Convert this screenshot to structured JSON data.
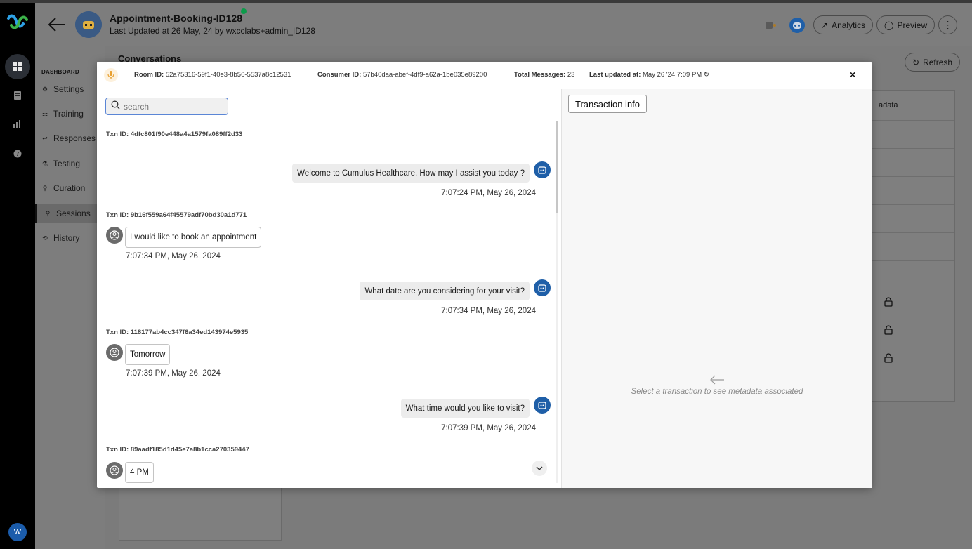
{
  "app": {
    "title": "Appointment-Booking-ID128",
    "subtitle": "Last Updated at 26 May, 24 by wxcclabs+admin_ID128",
    "avatar_letter": "W"
  },
  "header": {
    "analytics_label": "Analytics",
    "preview_label": "Preview",
    "more_label": "⋮"
  },
  "sidebar": {
    "caption": "DASHBOARD",
    "items": [
      {
        "label": "Settings",
        "icon": "⚙"
      },
      {
        "label": "Training",
        "icon": "⚏"
      },
      {
        "label": "Responses",
        "icon": "↩"
      },
      {
        "label": "Testing",
        "icon": "⚗"
      },
      {
        "label": "Curation",
        "icon": "⚲"
      },
      {
        "label": "Sessions",
        "icon": "⚲",
        "active": true
      },
      {
        "label": "History",
        "icon": "⟲"
      }
    ]
  },
  "page": {
    "title": "Conversations",
    "refresh_label": "Refresh",
    "table_header_partial": "adata"
  },
  "modal": {
    "room_label": "Room ID:",
    "room_id": "52a75316-59f1-40e3-8b56-5537a8c12531",
    "consumer_label": "Consumer ID:",
    "consumer_id": "57b40daa-abef-4df9-a62a-1be035e89200",
    "total_label": "Total Messages:",
    "total_messages": "23",
    "updated_label": "Last updated at:",
    "updated_at": "May 26 '24 7:09 PM",
    "close_label": "×",
    "search_placeholder": "search",
    "transaction_info_label": "Transaction info",
    "empty_state": "Select a transaction to see metadata associated",
    "txns": [
      "Txn ID: 4dfc801f90e448a4a1579fa089ff2d33",
      "Txn ID: 9b16f559a64f45579adf70bd30a1d771",
      "Txn ID: 118177ab4cc347f6a34ed143974e5935",
      "Txn ID: 89aadf185d1d45e7a8b1cca270359447"
    ],
    "messages": [
      {
        "from": "bot",
        "text": "Welcome to Cumulus Healthcare. How may I assist you today ?",
        "time": "7:07:24 PM, May 26, 2024"
      },
      {
        "from": "user",
        "text": "I would like to book an appointment",
        "time": "7:07:34 PM, May 26, 2024"
      },
      {
        "from": "bot",
        "text": "What date are you considering for your visit?",
        "time": "7:07:34 PM, May 26, 2024"
      },
      {
        "from": "user",
        "text": "Tomorrow",
        "time": "7:07:39 PM, May 26, 2024"
      },
      {
        "from": "bot",
        "text": "What time would you like to visit?",
        "time": "7:07:39 PM, May 26, 2024"
      },
      {
        "from": "user",
        "text": "4 PM",
        "time": ""
      }
    ]
  },
  "colors": {
    "accent": "#1f5fa8",
    "online": "#0c9b4a",
    "search_border": "#5b86d6"
  },
  "icons": [
    "webex-logo",
    "dashboard-icon",
    "document-icon",
    "chart-icon",
    "help-icon",
    "back-arrow-icon",
    "robot-icon",
    "analytics-icon",
    "chat-icon",
    "refresh-icon",
    "mic-icon",
    "close-icon",
    "search-icon",
    "bot-icon",
    "user-icon",
    "chevron-down-icon",
    "arrow-left-icon",
    "lock-icon"
  ]
}
